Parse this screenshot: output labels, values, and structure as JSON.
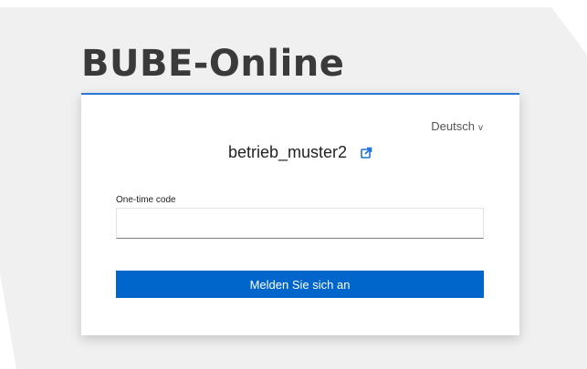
{
  "app": {
    "title": "BUBE-Online"
  },
  "login": {
    "language": "Deutsch",
    "language_chevron": "v",
    "username": "betrieb_muster2",
    "otp_label": "One-time code",
    "otp_value": "",
    "submit_label": "Melden Sie sich an"
  },
  "colors": {
    "accent": "#0066cc",
    "card_top_border": "#2a78d4",
    "background_shape": "#f0f0f0"
  }
}
